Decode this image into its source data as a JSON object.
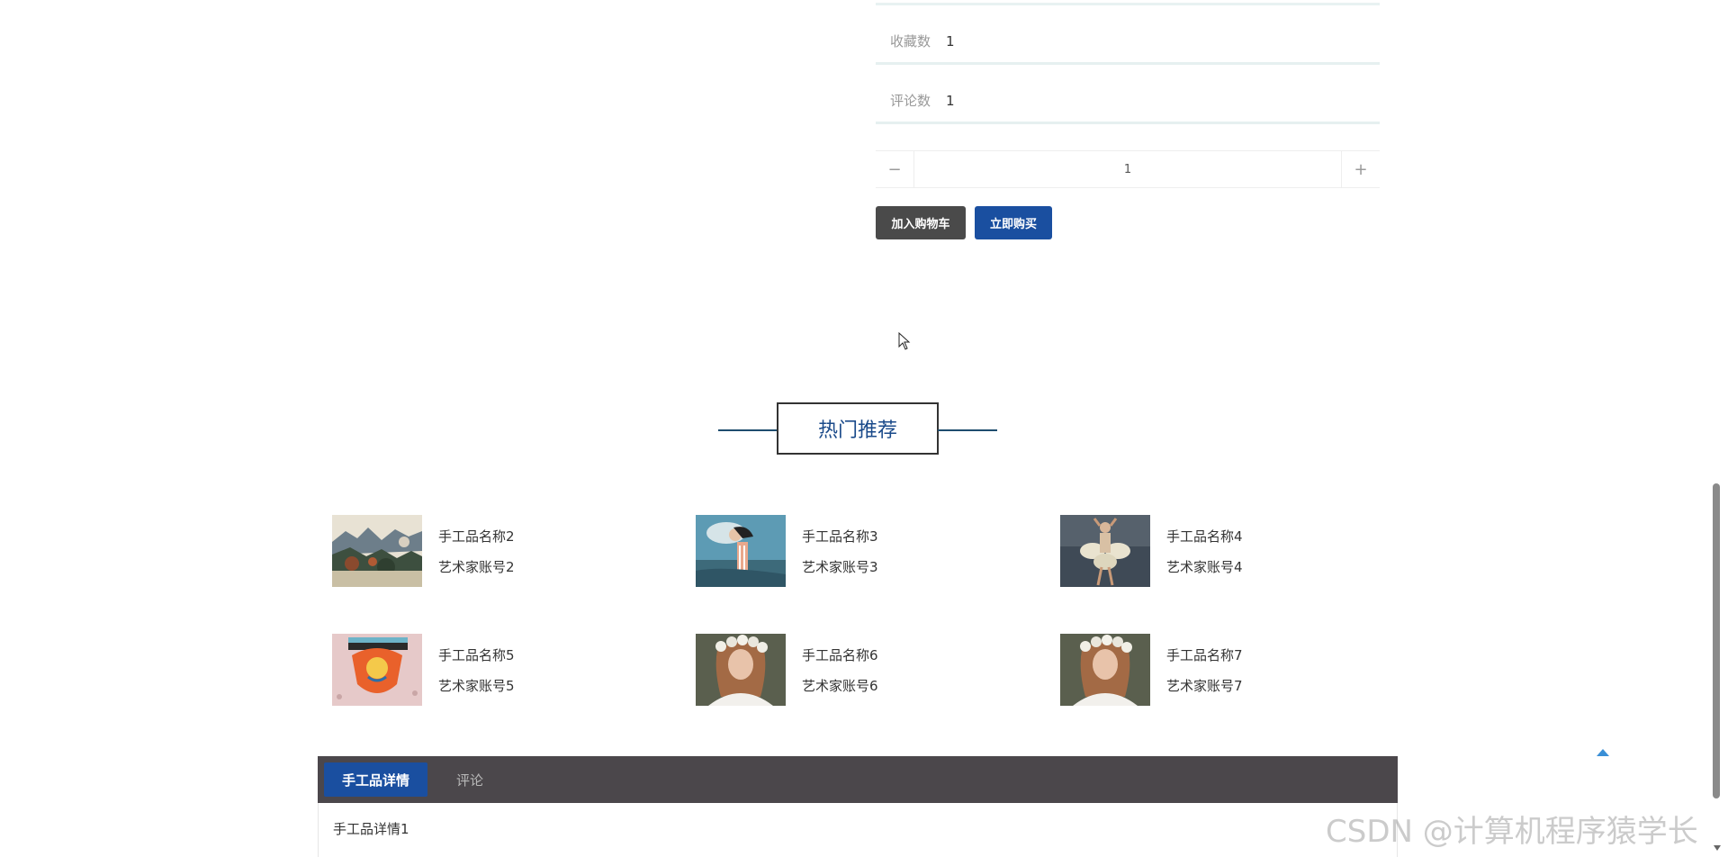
{
  "product_info": {
    "favorites_label": "收藏数",
    "favorites_value": "1",
    "comments_label": "评论数",
    "comments_value": "1"
  },
  "quantity": {
    "minus": "−",
    "value": "1",
    "plus": "+"
  },
  "actions": {
    "add_to_cart": "加入购物车",
    "buy_now": "立即购买"
  },
  "recommend": {
    "title": "热门推荐",
    "items": [
      {
        "name": "手工品名称2",
        "artist": "艺术家账号2",
        "image": "landscape-painting"
      },
      {
        "name": "手工品名称3",
        "artist": "艺术家账号3",
        "image": "surreal-woman-painting"
      },
      {
        "name": "手工品名称4",
        "artist": "艺术家账号4",
        "image": "dancer-figure"
      },
      {
        "name": "手工品名称5",
        "artist": "艺术家账号5",
        "image": "mosaic-heart"
      },
      {
        "name": "手工品名称6",
        "artist": "艺术家账号6",
        "image": "girl-flower-crown"
      },
      {
        "name": "手工品名称7",
        "artist": "艺术家账号7",
        "image": "girl-flower-crown"
      }
    ]
  },
  "tabs": {
    "details": "手工品详情",
    "comments": "评论",
    "active": "details"
  },
  "detail_content": "手工品详情1",
  "watermark": "CSDN @计算机程序猿学长",
  "colors": {
    "primary": "#1a4fa0",
    "dark_button": "#4a4a4a",
    "tab_bar": "#4b474b",
    "title_text": "#1a4a8a"
  }
}
